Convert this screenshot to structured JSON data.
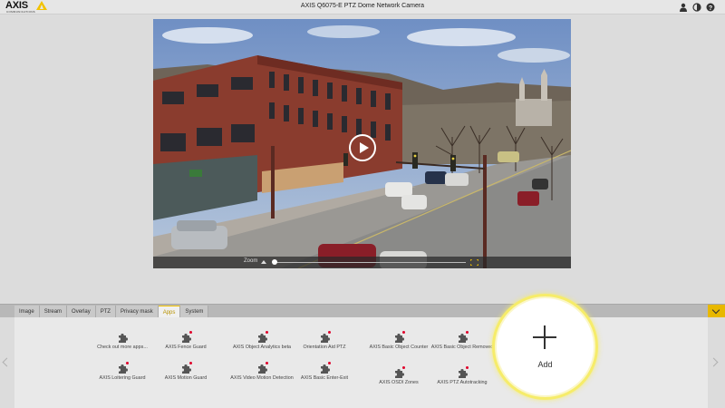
{
  "header": {
    "logo_text": "AXIS",
    "logo_sub": "COMMUNICATIONS",
    "title": "AXIS Q6075-E PTZ Dome Network Camera",
    "icons": [
      "user-icon",
      "contrast-icon",
      "help-icon"
    ]
  },
  "video": {
    "zoom_label": "Zoom",
    "zoom_level": 0.0
  },
  "tabs": [
    {
      "label": "Image"
    },
    {
      "label": "Stream"
    },
    {
      "label": "Overlay"
    },
    {
      "label": "PTZ"
    },
    {
      "label": "Privacy mask"
    },
    {
      "label": "Apps"
    },
    {
      "label": "System"
    }
  ],
  "active_tab": "Apps",
  "apps": [
    {
      "label": "Check out more apps...",
      "icon": "puzzle-icon",
      "badge": false
    },
    {
      "label": "AXIS Fence Guard",
      "icon": "puzzle-icon",
      "badge": true
    },
    {
      "label": "AXIS Object Analytics beta",
      "icon": "puzzle-icon",
      "badge": true
    },
    {
      "label": "Orientation Aid PTZ",
      "icon": "puzzle-icon",
      "badge": true
    },
    {
      "label": "AXIS Basic Object Counter",
      "icon": "puzzle-icon",
      "badge": true
    },
    {
      "label": "AXIS Basic Object Removed",
      "icon": "puzzle-icon",
      "badge": true
    },
    {
      "label": "AXIS Loitering Guard",
      "icon": "puzzle-icon",
      "badge": true
    },
    {
      "label": "AXIS Motion Guard",
      "icon": "puzzle-icon",
      "badge": true
    },
    {
      "label": "AXIS Video Motion Detection",
      "icon": "puzzle-icon",
      "badge": true
    },
    {
      "label": "AXIS Basic Enter-Exit",
      "icon": "puzzle-icon",
      "badge": true
    },
    {
      "label": "AXIS OSDI Zones",
      "icon": "puzzle-icon",
      "badge": true
    },
    {
      "label": "AXIS PTZ Autotracking",
      "icon": "puzzle-icon",
      "badge": true
    }
  ],
  "add_button": {
    "label": "Add"
  },
  "colors": {
    "accent": "#f2c200",
    "badge": "#e0002a",
    "highlight": "#f6ec6a"
  }
}
